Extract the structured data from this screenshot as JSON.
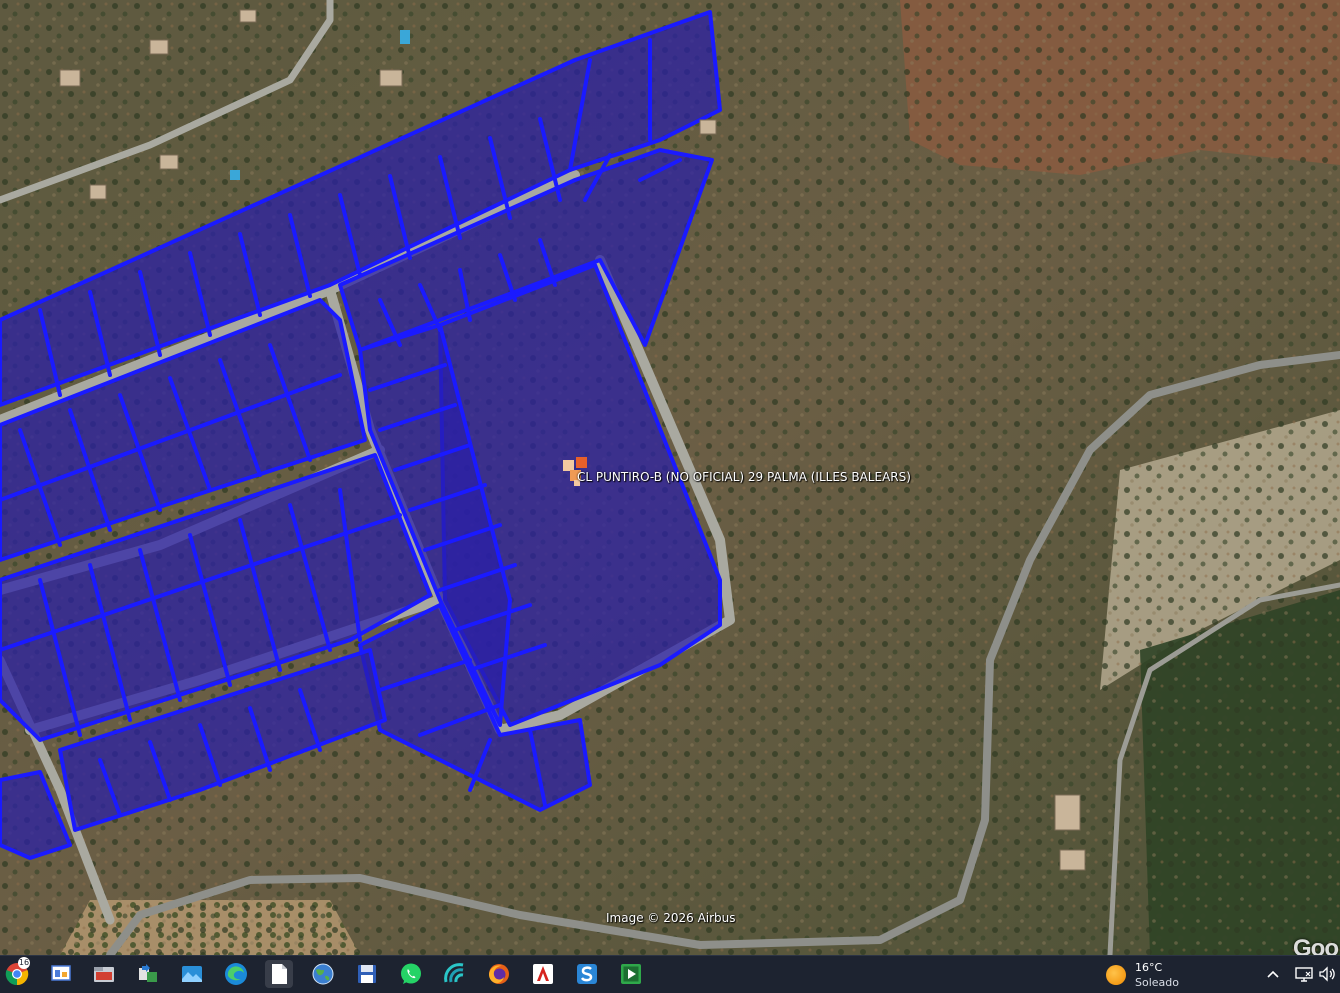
{
  "map": {
    "placemark_label": "CL PUNTIRO-B (NO OFICIAL) 29  PALMA (ILLES BALEARS)",
    "attribution": "Image © 2026 Airbus",
    "logo": "Goo",
    "parcel_color": "#1a1aff",
    "parcel_fill": "#2a1fa8",
    "road_color": "#a9a9a0"
  },
  "taskbar": {
    "apps": [
      {
        "name": "chrome",
        "icon": "chrome-icon",
        "badge": "16"
      },
      {
        "name": "presentation",
        "icon": "presentation-icon"
      },
      {
        "name": "file-explorer",
        "icon": "folder-icon"
      },
      {
        "name": "transfer-tool",
        "icon": "transfer-icon"
      },
      {
        "name": "photos",
        "icon": "photos-icon"
      },
      {
        "name": "edge",
        "icon": "edge-icon"
      },
      {
        "name": "notepad",
        "icon": "document-icon"
      },
      {
        "name": "google-earth",
        "icon": "globe-icon"
      },
      {
        "name": "save-tool",
        "icon": "floppy-disk-icon"
      },
      {
        "name": "whatsapp",
        "icon": "whatsapp-icon"
      },
      {
        "name": "wave-app",
        "icon": "wave-icon"
      },
      {
        "name": "firefox",
        "icon": "firefox-icon"
      },
      {
        "name": "acrobat",
        "icon": "acrobat-icon"
      },
      {
        "name": "s-app",
        "icon": "s-app-icon"
      },
      {
        "name": "media-player",
        "icon": "play-icon"
      }
    ],
    "weather": {
      "temp": "16°C",
      "condition": "Soleado",
      "icon": "sun-icon"
    },
    "tray": [
      {
        "name": "show-hidden",
        "icon": "chevron-up-icon"
      },
      {
        "name": "display",
        "icon": "monitor-icon"
      },
      {
        "name": "volume",
        "icon": "speaker-icon"
      }
    ]
  }
}
